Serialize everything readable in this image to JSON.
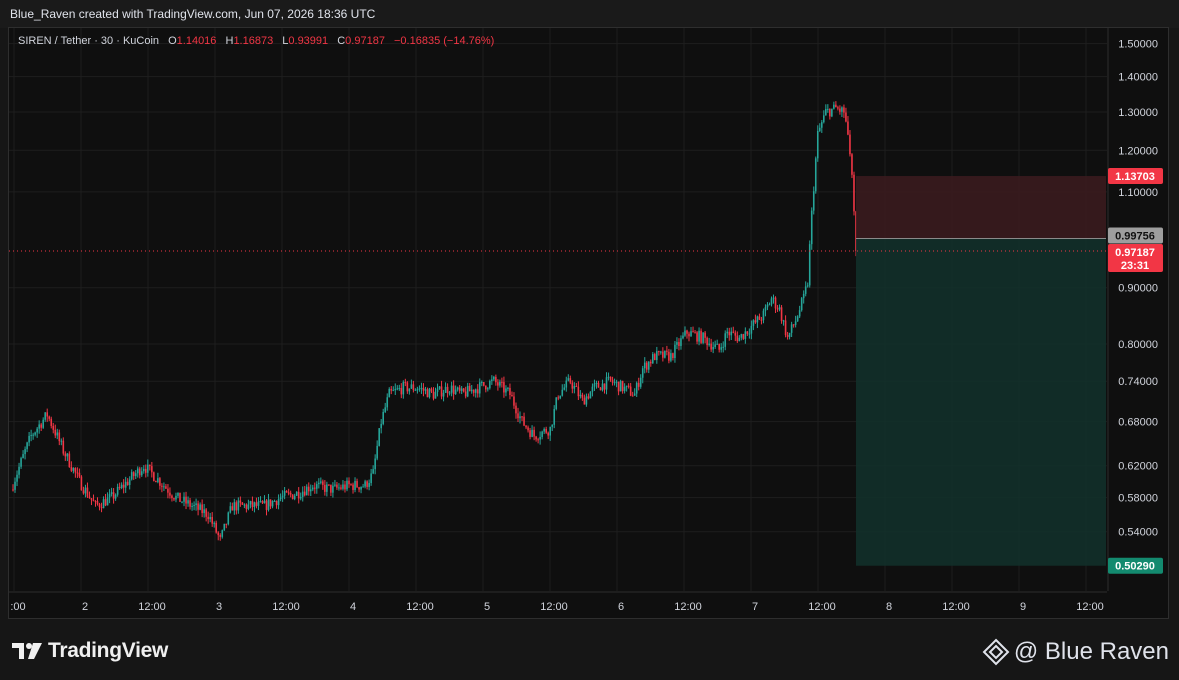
{
  "header": {
    "text": "Blue_Raven created with TradingView.com, Jun 07, 2026 18:36 UTC"
  },
  "legend": {
    "symbol": "SIREN / Tether · 30 · KuCoin",
    "o_label": "O",
    "o_value": "1.14016",
    "h_label": "H",
    "h_value": "1.16873",
    "l_label": "L",
    "l_value": "0.93991",
    "c_label": "C",
    "c_value": "0.97187",
    "change": "−0.16835 (−14.76%)"
  },
  "price_labels": {
    "stop": "1.13703",
    "entry": "0.99756",
    "last": "0.97187",
    "countdown": "23:31",
    "target": "0.50290"
  },
  "colors": {
    "up": "#26a69a",
    "down": "#f23645",
    "background": "#0f0f0f",
    "grid": "#1e1e1e",
    "stop_zone": "#3a1b1e",
    "target_zone": "#12302a"
  },
  "footer": {
    "brand": "TradingView",
    "author": "@ Blue Raven"
  },
  "chart_data": {
    "type": "candlestick",
    "scale": "log",
    "y_axis": {
      "ticks": [
        "1.50000",
        "1.40000",
        "1.30000",
        "1.20000",
        "1.10000",
        "0.90000",
        "0.80000",
        "0.74000",
        "0.68000",
        "0.62000",
        "0.58000",
        "0.54000"
      ]
    },
    "x_axis": {
      "ticks": [
        ":00",
        "2",
        "12:00",
        "3",
        "12:00",
        "4",
        "12:00",
        "5",
        "12:00",
        "6",
        "12:00",
        "7",
        "12:00",
        "8",
        "12:00",
        "9",
        "12:00"
      ]
    },
    "ylim": [
      0.477,
      1.55
    ],
    "last_price": 0.97187,
    "position": {
      "direction": "short",
      "entry": 0.99756,
      "stop": 1.13703,
      "target": 0.5029
    },
    "close_path": [
      [
        0,
        0.59
      ],
      [
        10,
        0.66
      ],
      [
        18,
        0.69
      ],
      [
        26,
        0.64
      ],
      [
        34,
        0.6
      ],
      [
        42,
        0.57
      ],
      [
        50,
        0.58
      ],
      [
        58,
        0.6
      ],
      [
        66,
        0.62
      ],
      [
        74,
        0.6
      ],
      [
        82,
        0.58
      ],
      [
        90,
        0.57
      ],
      [
        98,
        0.56
      ],
      [
        104,
        0.53
      ],
      [
        110,
        0.57
      ],
      [
        118,
        0.57
      ],
      [
        126,
        0.57
      ],
      [
        134,
        0.58
      ],
      [
        142,
        0.585
      ],
      [
        150,
        0.595
      ],
      [
        160,
        0.59
      ],
      [
        168,
        0.595
      ],
      [
        176,
        0.595
      ],
      [
        180,
        0.61
      ],
      [
        184,
        0.68
      ],
      [
        188,
        0.72
      ],
      [
        195,
        0.73
      ],
      [
        202,
        0.73
      ],
      [
        210,
        0.72
      ],
      [
        218,
        0.73
      ],
      [
        224,
        0.72
      ],
      [
        232,
        0.73
      ],
      [
        240,
        0.74
      ],
      [
        248,
        0.72
      ],
      [
        254,
        0.68
      ],
      [
        260,
        0.66
      ],
      [
        268,
        0.67
      ],
      [
        272,
        0.72
      ],
      [
        278,
        0.74
      ],
      [
        284,
        0.71
      ],
      [
        290,
        0.73
      ],
      [
        298,
        0.74
      ],
      [
        304,
        0.73
      ],
      [
        310,
        0.72
      ],
      [
        314,
        0.76
      ],
      [
        320,
        0.78
      ],
      [
        328,
        0.78
      ],
      [
        336,
        0.82
      ],
      [
        344,
        0.81
      ],
      [
        352,
        0.79
      ],
      [
        356,
        0.82
      ],
      [
        362,
        0.81
      ],
      [
        368,
        0.83
      ],
      [
        374,
        0.85
      ],
      [
        378,
        0.88
      ],
      [
        382,
        0.86
      ],
      [
        386,
        0.81
      ],
      [
        390,
        0.84
      ],
      [
        394,
        0.88
      ],
      [
        396,
        0.91
      ],
      [
        398,
        1.05
      ],
      [
        401,
        1.24
      ],
      [
        405,
        1.3
      ],
      [
        410,
        1.31
      ],
      [
        414,
        1.3
      ],
      [
        416,
        1.24
      ],
      [
        418,
        1.14
      ],
      [
        420,
        0.97187
      ]
    ]
  }
}
